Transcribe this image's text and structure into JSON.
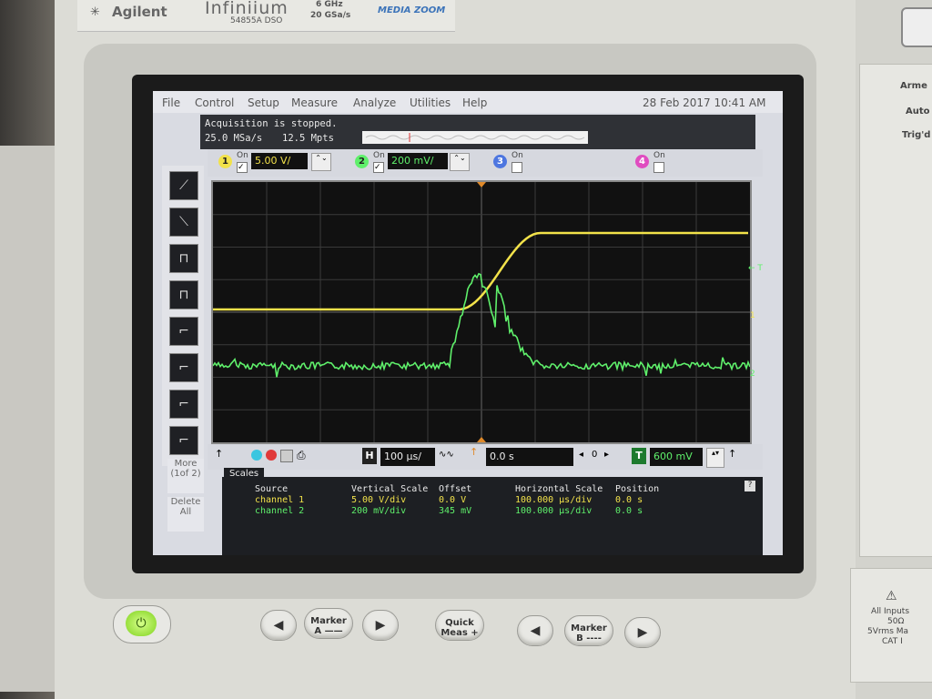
{
  "brand": {
    "logo": "Agilent",
    "model_line1": "Infiniium",
    "model_line2": "54855A DSO",
    "spec_line1": "6 GHz",
    "spec_line2": "20 GSa/s",
    "mediazoom": "MEDIA ZOOM"
  },
  "menu": [
    "File",
    "Control",
    "Setup",
    "Measure",
    "Analyze",
    "Utilities",
    "Help"
  ],
  "datetime": "28 Feb 2017 10:41 AM",
  "acquisition": {
    "status": "Acquisition is stopped.",
    "rate": "25.0 MSa/s",
    "points": "12.5 Mpts"
  },
  "channels": [
    {
      "num": "1",
      "on_label": "On",
      "scale": "5.00 V/",
      "color": "#f2e24a"
    },
    {
      "num": "2",
      "on_label": "On",
      "scale": "200 mV/",
      "color": "#5ff06b"
    },
    {
      "num": "3",
      "on_label": "On",
      "scale": "",
      "color": "#4d76e0"
    },
    {
      "num": "4",
      "on_label": "On",
      "scale": "",
      "color": "#e04dc0"
    }
  ],
  "grid_labels": {
    "trigger_marker": "← T",
    "ch1_marker": "1",
    "ch2_marker": "2"
  },
  "side_buttons": {
    "more": "More",
    "more_page": "(1of 2)",
    "delete": "Delete",
    "delete2": "All"
  },
  "bottom": {
    "h_label": "H",
    "timebase": "100 µs/",
    "delay": "0.0 s",
    "pos": "0",
    "t_label": "T",
    "trigger_level": "600 mV"
  },
  "scales": {
    "tab": "Scales",
    "headers": [
      "Source",
      "Vertical Scale",
      "Offset",
      "Horizontal Scale",
      "Position"
    ],
    "rows": [
      {
        "source": "channel 1",
        "vscale": "5.00 V/div",
        "offset": "0.0 V",
        "hscale": "100.000 µs/div",
        "position": "0.0 s",
        "color": "#f2e24a"
      },
      {
        "source": "channel 2",
        "vscale": "200 mV/div",
        "offset": "345 mV",
        "hscale": "100.000 µs/div",
        "position": "0.0 s",
        "color": "#5ff06b"
      }
    ],
    "help": "?"
  },
  "front_panel": {
    "marker_a": "Marker\nA ——",
    "quick_meas": "Quick\nMeas +",
    "marker_b": "Marker\nB ----"
  },
  "right_panel": {
    "line1": "Arme",
    "line2": "Auto",
    "line3": "Trig'd",
    "inputs1": "All Inputs",
    "inputs2": "50Ω",
    "inputs3": "5Vrms Ma",
    "inputs4": "CAT I"
  }
}
